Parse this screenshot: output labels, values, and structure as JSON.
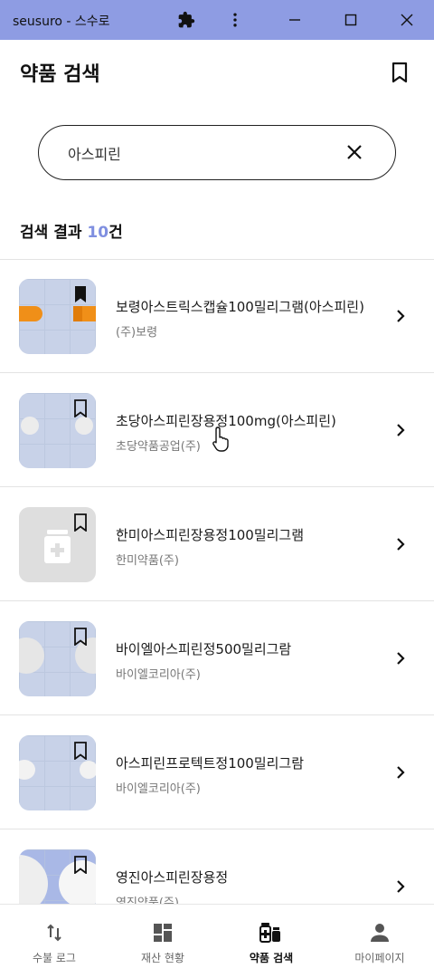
{
  "window": {
    "title": "seusuro - 스수로",
    "icons": [
      "puzzle-icon",
      "more-vertical-icon",
      "minimize-icon",
      "maximize-icon",
      "close-icon"
    ]
  },
  "header": {
    "title": "약품 검색",
    "bookmark_icon": "bookmark-icon"
  },
  "search": {
    "value": "아스피린",
    "clear_icon": "clear-icon"
  },
  "results": {
    "label": "검색 결과",
    "count": "10",
    "suffix": "건"
  },
  "items": [
    {
      "name": "보령아스트릭스캡슐100밀리그램(아스피린)",
      "company": "(주)보령",
      "thumb": "orange-capsule",
      "bookmarked": true
    },
    {
      "name": "초당아스피린장용정100mg(아스피린)",
      "company": "초당약품공업(주)",
      "thumb": "white-tablet",
      "bookmarked": false
    },
    {
      "name": "한미아스피린장용정100밀리그램",
      "company": "한미약품(주)",
      "thumb": "placeholder",
      "bookmarked": false
    },
    {
      "name": "바이엘아스피린정500밀리그람",
      "company": "바이엘코리아(주)",
      "thumb": "large-white-tablet",
      "bookmarked": false
    },
    {
      "name": "아스피린프로텍트정100밀리그람",
      "company": "바이엘코리아(주)",
      "thumb": "white-tablet-small",
      "bookmarked": false
    },
    {
      "name": "영진아스피린장용정",
      "company": "영진약품(주)",
      "thumb": "as-tablet",
      "bookmarked": false
    }
  ],
  "nav": [
    {
      "label": "수불 로그",
      "icon": "swap-vertical-icon",
      "active": false
    },
    {
      "label": "재산 현황",
      "icon": "dashboard-icon",
      "active": false
    },
    {
      "label": "약품 검색",
      "icon": "medicine-icon",
      "active": true
    },
    {
      "label": "마이페이지",
      "icon": "person-icon",
      "active": false
    }
  ],
  "colors": {
    "titlebar": "#8e9ce3",
    "accent": "#7f8fe0",
    "thumb_blue": "#c8d2e8"
  }
}
